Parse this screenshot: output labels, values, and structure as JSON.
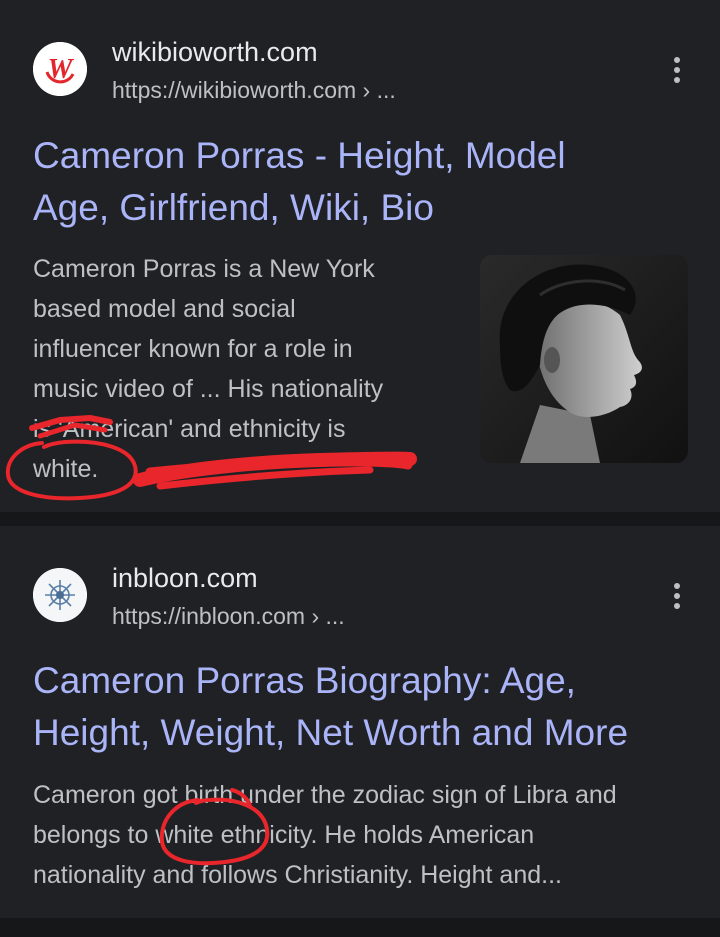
{
  "results": [
    {
      "site_name": "wikibioworth.com",
      "url": "https://wikibioworth.com › ...",
      "favicon_letter": "W",
      "favicon_icon": "wikibioworth-logo-icon",
      "title_lines": [
        "Cameron Porras - Height, Model",
        "Age, Girlfriend, Wiki, Bio"
      ],
      "snippet_lines": [
        "Cameron Porras is a New York",
        "based model and social",
        "influencer known for a role in",
        "music video of ... His nationality",
        "is 'American' and ethnicity is",
        "white."
      ],
      "thumbnail_icon": "profile-photo-thumbnail"
    },
    {
      "site_name": "inbloon.com",
      "url": "https://inbloon.com › ...",
      "favicon_icon": "inbloon-logo-icon",
      "title_lines": [
        "Cameron Porras Biography: Age,",
        "Height, Weight, Net Worth and More"
      ],
      "snippet_lines": [
        "Cameron got birth under the zodiac sign of Libra and",
        "belongs to white ethnicity. He holds American",
        "nationality and follows Christianity. Height and..."
      ]
    }
  ],
  "colors": {
    "background": "#202124",
    "separator": "#161719",
    "title": "#aab4f8",
    "text": "#bdc1c6",
    "site_name": "#e8eaed",
    "annotation_red": "#e8262b",
    "favicon_red": "#e3262b"
  },
  "menu_icon": "more-vert-icon"
}
